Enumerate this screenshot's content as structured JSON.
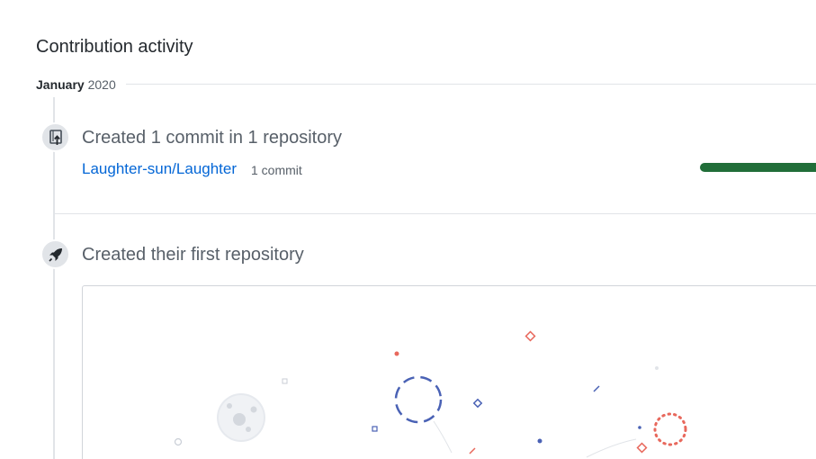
{
  "section": {
    "heading": "Contribution activity"
  },
  "month": {
    "name": "January",
    "year": "2020"
  },
  "commits_item": {
    "icon": "repo-push-icon",
    "title": "Created 1 commit in 1 repository",
    "repo_name": "Laughter-sun/Laughter",
    "commit_count": "1 commit",
    "progress_fraction": 1.0,
    "progress_color": "#216e39"
  },
  "repository_item": {
    "icon": "rocket-icon",
    "title": "Created their first repository",
    "illustration": "space-illustration"
  },
  "colors": {
    "link": "#0366d6",
    "muted": "#586069",
    "border": "#e1e4e8",
    "accent_red": "#e8685c",
    "accent_blue": "#4a62b5"
  }
}
